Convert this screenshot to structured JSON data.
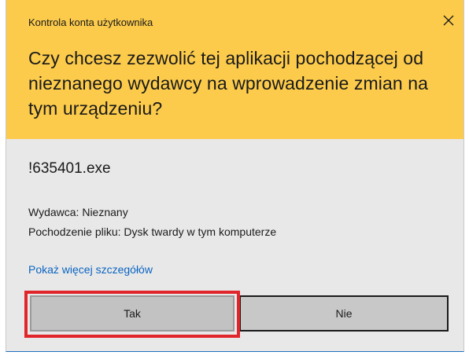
{
  "window": {
    "title": "Kontrola konta użytkownika",
    "close_icon": "close-icon"
  },
  "header": {
    "question": "Czy chcesz zezwolić tej aplikacji pochodzącej od nieznanego wydawcy na wprowadzenie zmian na tym urządzeniu?"
  },
  "details": {
    "program_name": "!635401.exe",
    "publisher": "Wydawca: Nieznany",
    "origin": "Pochodzenie pliku: Dysk twardy w tym komputerze",
    "more_details_link": "Pokaż więcej szczegółów"
  },
  "buttons": {
    "yes_label": "Tak",
    "no_label": "Nie"
  },
  "colors": {
    "header_bg": "#fccb4b",
    "body_bg": "#e8e8e8",
    "link": "#0a64c2",
    "highlight": "#e0262b"
  }
}
